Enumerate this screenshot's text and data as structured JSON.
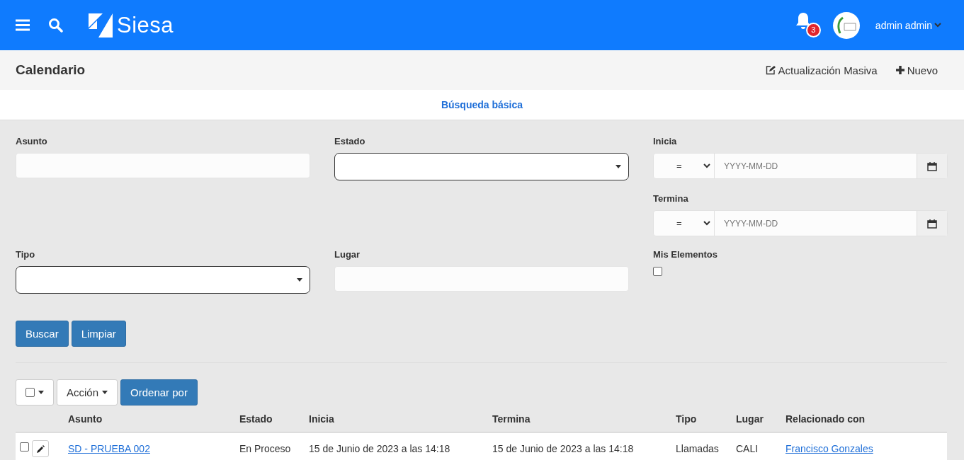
{
  "header": {
    "brand": "Siesa",
    "notifications": "3",
    "user": "admin admin"
  },
  "title_bar": {
    "title": "Calendario",
    "actions": [
      {
        "kind": "edit",
        "label": "Actualización Masiva"
      },
      {
        "kind": "add",
        "label": "Nuevo"
      }
    ]
  },
  "search_tabs": [
    {
      "label": "Búsqueda básica",
      "selected": true
    }
  ],
  "filters": {
    "asunto": {
      "label": "Asunto"
    },
    "estado": {
      "label": "Estado"
    },
    "inicia": {
      "label": "Inicia",
      "operator": "=",
      "placeholder": "YYYY-MM-DD"
    },
    "termina": {
      "label": "Termina",
      "operator": "=",
      "placeholder": "YYYY-MM-DD"
    },
    "tipo": {
      "label": "Tipo"
    },
    "lugar": {
      "label": "Lugar"
    },
    "mis_elementos": {
      "label": "Mis Elementos",
      "checked": false
    }
  },
  "filter_buttons": [
    "Buscar",
    "Limpiar"
  ],
  "list_toolbar": {
    "select_all_checked": false,
    "action": "Acción",
    "sort": "Ordenar por"
  },
  "table": {
    "columns": [
      "Asunto",
      "Estado",
      "Inicia",
      "Termina",
      "Tipo",
      "Lugar",
      "Relacionado con"
    ],
    "rows": [
      {
        "checked": false,
        "asunto": "SD - PRUEBA 002",
        "estado": "En Proceso",
        "inicia": "15 de Junio de 2023 a las 14:18",
        "termina": "15 de Junio de 2023 a las 14:18",
        "tipo": "Llamadas",
        "lugar": "CALI",
        "relacionado": "Francisco Gonzales"
      }
    ]
  }
}
